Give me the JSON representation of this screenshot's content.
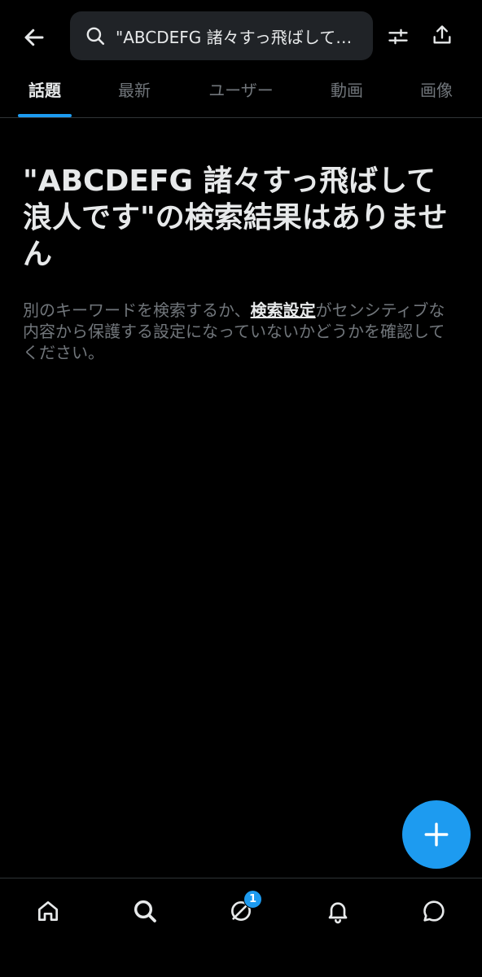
{
  "header": {
    "back_icon": "arrow-left-icon",
    "search_icon": "search-icon",
    "search_query": "\"ABCDEFG 諸々すっ飛ばして浪人です\"",
    "filter_icon": "sliders-icon",
    "share_icon": "share-icon"
  },
  "tabs": [
    {
      "label": "話題",
      "active": true
    },
    {
      "label": "最新",
      "active": false
    },
    {
      "label": "ユーザー",
      "active": false
    },
    {
      "label": "動画",
      "active": false
    },
    {
      "label": "画像",
      "active": false
    }
  ],
  "empty_state": {
    "title": "\"ABCDEFG 諸々すっ飛ばして浪人です\"の検索結果はありません",
    "desc_before": "別のキーワードを検索するか、",
    "desc_link": "検索設定",
    "desc_after": "がセンシティブな内容から保護する設定になっていないかどうかを確認してください。"
  },
  "fab": {
    "icon": "plus-icon"
  },
  "bottom_nav": {
    "items": [
      {
        "icon": "home-icon"
      },
      {
        "icon": "search-icon"
      },
      {
        "icon": "spaces-icon",
        "badge": "1"
      },
      {
        "icon": "bell-icon"
      },
      {
        "icon": "messages-icon"
      }
    ]
  },
  "colors": {
    "background": "#000000",
    "accent": "#1d9bf0",
    "text_primary": "#e7e9ea",
    "text_secondary": "#71767b",
    "search_bg": "#202327"
  }
}
